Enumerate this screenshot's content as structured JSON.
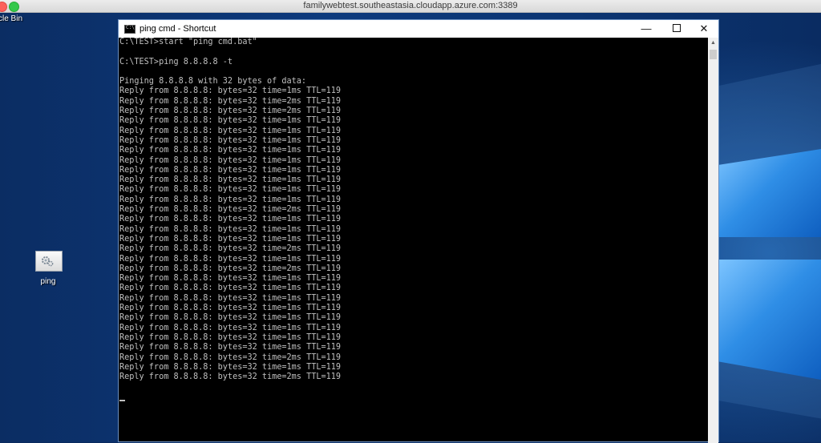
{
  "mac_window": {
    "title": "familywebtest.southeastasia.cloudapp.azure.com:3389"
  },
  "desktop": {
    "recycle_bin_label": "cle Bin",
    "shortcut_label": "ping",
    "shortcut_icon": "gear-icon"
  },
  "cmd": {
    "title": "ping cmd - Shortcut",
    "icon": "cmd-icon",
    "buttons": {
      "minimize": "—",
      "close": "✕"
    },
    "lines": [
      "C:\\TEST>start \"ping cmd.bat\"",
      "",
      "C:\\TEST>ping 8.8.8.8 -t",
      "",
      "Pinging 8.8.8.8 with 32 bytes of data:",
      "Reply from 8.8.8.8: bytes=32 time=1ms TTL=119",
      "Reply from 8.8.8.8: bytes=32 time=2ms TTL=119",
      "Reply from 8.8.8.8: bytes=32 time=2ms TTL=119",
      "Reply from 8.8.8.8: bytes=32 time=1ms TTL=119",
      "Reply from 8.8.8.8: bytes=32 time=1ms TTL=119",
      "Reply from 8.8.8.8: bytes=32 time=1ms TTL=119",
      "Reply from 8.8.8.8: bytes=32 time=1ms TTL=119",
      "Reply from 8.8.8.8: bytes=32 time=1ms TTL=119",
      "Reply from 8.8.8.8: bytes=32 time=1ms TTL=119",
      "Reply from 8.8.8.8: bytes=32 time=1ms TTL=119",
      "Reply from 8.8.8.8: bytes=32 time=1ms TTL=119",
      "Reply from 8.8.8.8: bytes=32 time=1ms TTL=119",
      "Reply from 8.8.8.8: bytes=32 time=2ms TTL=119",
      "Reply from 8.8.8.8: bytes=32 time=1ms TTL=119",
      "Reply from 8.8.8.8: bytes=32 time=1ms TTL=119",
      "Reply from 8.8.8.8: bytes=32 time=1ms TTL=119",
      "Reply from 8.8.8.8: bytes=32 time=2ms TTL=119",
      "Reply from 8.8.8.8: bytes=32 time=1ms TTL=119",
      "Reply from 8.8.8.8: bytes=32 time=2ms TTL=119",
      "Reply from 8.8.8.8: bytes=32 time=1ms TTL=119",
      "Reply from 8.8.8.8: bytes=32 time=1ms TTL=119",
      "Reply from 8.8.8.8: bytes=32 time=1ms TTL=119",
      "Reply from 8.8.8.8: bytes=32 time=1ms TTL=119",
      "Reply from 8.8.8.8: bytes=32 time=1ms TTL=119",
      "Reply from 8.8.8.8: bytes=32 time=1ms TTL=119",
      "Reply from 8.8.8.8: bytes=32 time=1ms TTL=119",
      "Reply from 8.8.8.8: bytes=32 time=1ms TTL=119",
      "Reply from 8.8.8.8: bytes=32 time=2ms TTL=119",
      "Reply from 8.8.8.8: bytes=32 time=1ms TTL=119",
      "Reply from 8.8.8.8: bytes=32 time=2ms TTL=119"
    ]
  },
  "colors": {
    "console_text": "#c0c0c0",
    "console_bg": "#000000",
    "desktop_bg": "#0c3572"
  }
}
